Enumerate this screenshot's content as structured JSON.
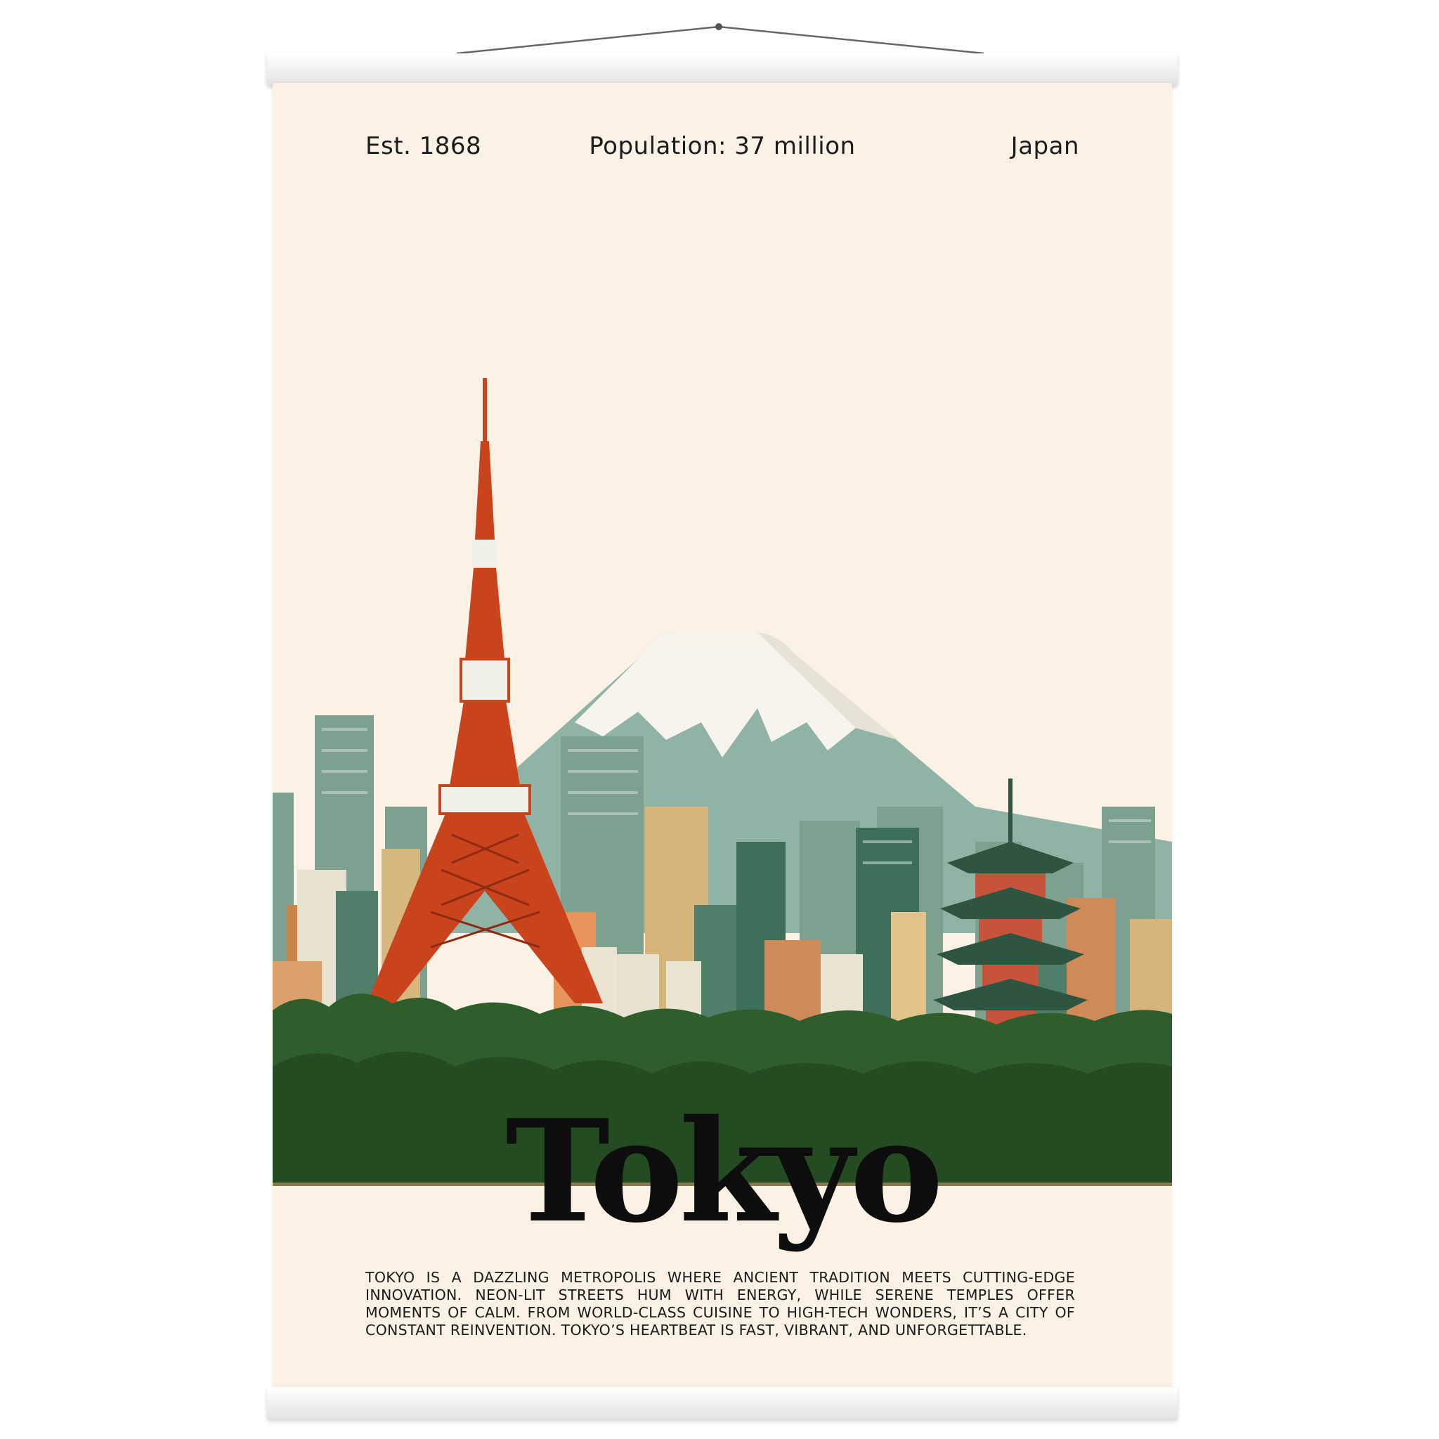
{
  "poster": {
    "established": "Est. 1868",
    "population": "Population: 37 million",
    "country": "Japan",
    "city": "Tokyo",
    "description": "Tokyo is a dazzling metropolis where ancient tradition meets cutting-edge innovation. Neon-lit streets hum with energy, while serene temples offer moments of calm. From world-class cuisine to high-tech wonders, it’s a city of constant reinvention. Tokyo’s heartbeat is fast, vibrant, and unforgettable."
  },
  "colors": {
    "paper": "#fbf1e4",
    "tower": "#c9431d",
    "mountain": "#8fb3a4",
    "snow": "#f7f4ee",
    "trees": "#2f5e2c",
    "ink": "#0d0d0d"
  }
}
